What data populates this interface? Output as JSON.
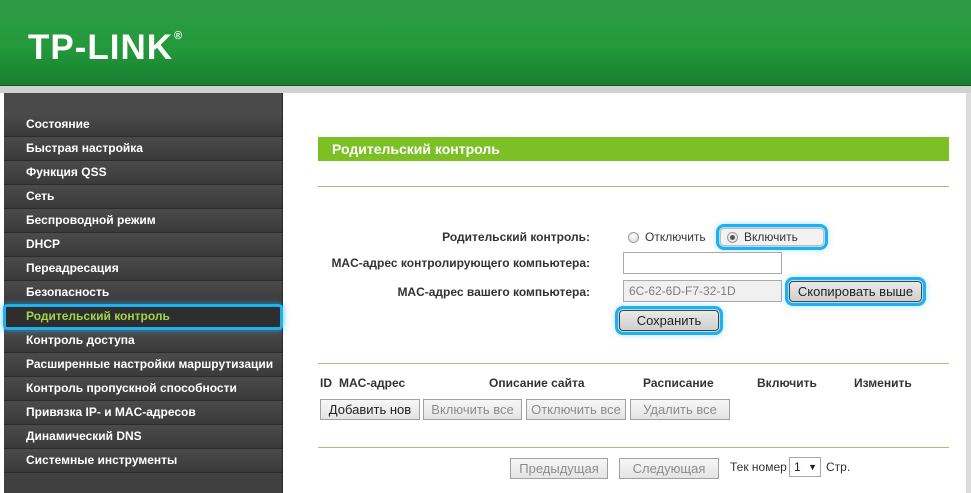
{
  "header": {
    "logo_text": "TP-LINK",
    "logo_mark": "®"
  },
  "sidebar": {
    "items": [
      {
        "label": "Состояние"
      },
      {
        "label": "Быстрая настройка"
      },
      {
        "label": "Функция QSS"
      },
      {
        "label": "Сеть"
      },
      {
        "label": "Беспроводной режим"
      },
      {
        "label": "DHCP"
      },
      {
        "label": "Переадресация"
      },
      {
        "label": "Безопасность"
      },
      {
        "label": "Родительский контроль",
        "active": true
      },
      {
        "label": "Контроль доступа"
      },
      {
        "label": "Расширенные настройки маршрутизации"
      },
      {
        "label": "Контроль пропускной способности"
      },
      {
        "label": "Привязка IP- и MAC-адресов"
      },
      {
        "label": "Динамический DNS"
      },
      {
        "label": "Системные инструменты"
      }
    ]
  },
  "main": {
    "title": "Родительский контроль",
    "form": {
      "parental_label": "Родительский контроль:",
      "option_off": "Отключить",
      "option_on": "Включить",
      "selected_option": "Включить",
      "controlling_mac_label": "MAC-адрес контролирующего компьютера:",
      "controlling_mac_value": "",
      "your_mac_label": "MAC-адрес вашего компьютера:",
      "your_mac_value": "6C-62-6D-F7-32-1D",
      "copy_button": "Скопировать выше",
      "save_button": "Сохранить"
    },
    "table": {
      "headers": {
        "id": "ID",
        "mac": "MAC-адрес",
        "site_desc": "Описание сайта",
        "schedule": "Расписание",
        "enable": "Включить",
        "edit": "Изменить"
      },
      "buttons": {
        "add_new": "Добавить нов",
        "enable_all": "Включить все",
        "disable_all": "Отключить все",
        "delete_all": "Удалить все"
      }
    },
    "pagination": {
      "prev": "Предыдущая",
      "next": "Следующая",
      "current_label": "Тек номер",
      "current_value": "1",
      "suffix": "Стр."
    }
  },
  "colors": {
    "header_green": "#239a3b",
    "title_green": "#7cc026",
    "sidebar_bg": "#404040",
    "active_item_text": "#a2d34d",
    "highlight_blue": "#1fb0f0"
  }
}
